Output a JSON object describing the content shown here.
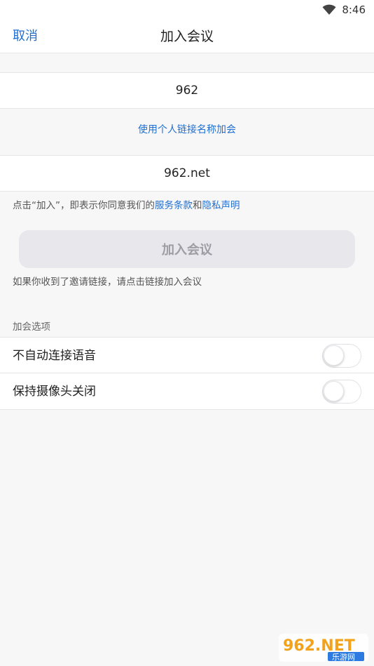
{
  "status_bar": {
    "time": "8:46",
    "icons": [
      "wifi-icon"
    ]
  },
  "nav": {
    "cancel_label": "取消",
    "title": "加入会议"
  },
  "meeting_id_input": {
    "value": "962"
  },
  "personal_link_label": "使用个人链接名称加会",
  "name_input": {
    "value": "962.net"
  },
  "agreement": {
    "prefix": "点击“加入”，即表示你同意我们的",
    "terms_link": "服务条款",
    "conjunction": "和",
    "privacy_link": "隐私声明"
  },
  "join_button_label": "加入会议",
  "invite_hint": "如果你收到了邀请链接，请点击链接加入会议",
  "options": {
    "section_title": "加会选项",
    "items": [
      {
        "label": "不自动连接语音",
        "checked": false
      },
      {
        "label": "保持摄像头关闭",
        "checked": false
      }
    ]
  },
  "watermark": {
    "brand": "962.NET",
    "subtitle": "乐游网"
  },
  "colors": {
    "accent": "#1f6fd1",
    "background": "#f7f7f8",
    "button_disabled_bg": "#e8e8ec",
    "button_disabled_text": "#9d9da3"
  }
}
